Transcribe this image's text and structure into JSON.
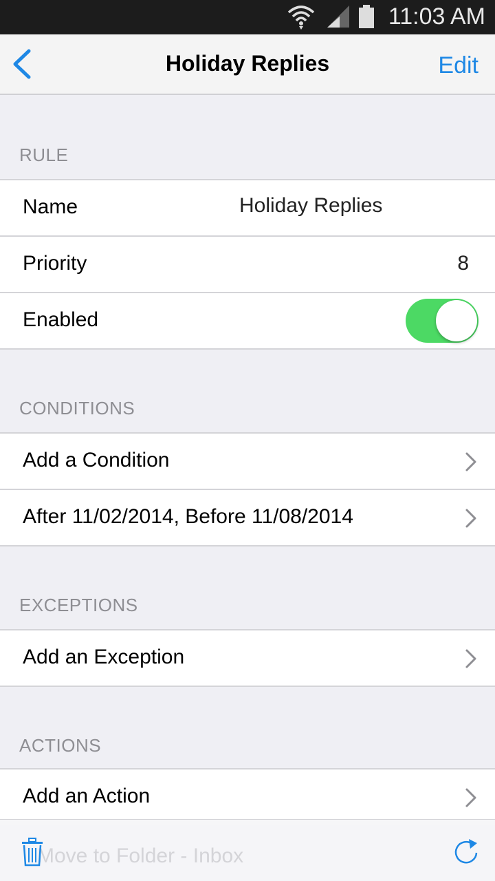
{
  "status_bar": {
    "time": "11:03 AM",
    "icons": [
      "wifi-icon",
      "signal-icon",
      "battery-icon"
    ]
  },
  "nav": {
    "back_icon": "chevron-left-icon",
    "title": "Holiday Replies",
    "edit_label": "Edit"
  },
  "rule": {
    "header": "RULE",
    "name_label": "Name",
    "name_value": "Holiday Replies",
    "priority_label": "Priority",
    "priority_value": "8",
    "enabled_label": "Enabled",
    "enabled": true
  },
  "conditions": {
    "header": "CONDITIONS",
    "items": [
      "Add a Condition",
      "After 11/02/2014, Before 11/08/2014"
    ]
  },
  "exceptions": {
    "header": "EXCEPTIONS",
    "items": [
      "Add an Exception"
    ]
  },
  "actions": {
    "header": "ACTIONS",
    "items": [
      "Add an Action",
      "Move to Folder -   Inbox"
    ]
  },
  "toolbar": {
    "icons": [
      "trash-icon",
      "refresh-icon"
    ]
  },
  "colors": {
    "accent": "#1e88e5",
    "toggle_on": "#4cd964",
    "background": "#efeff4"
  }
}
